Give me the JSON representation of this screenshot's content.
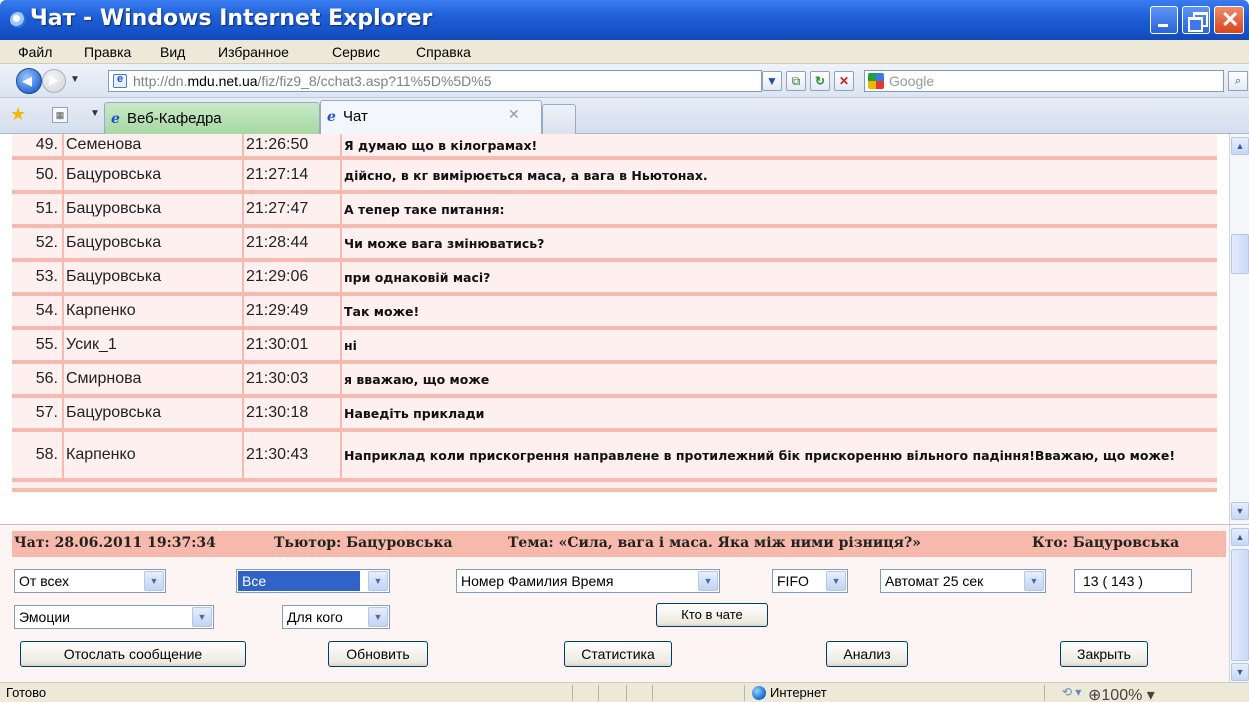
{
  "window": {
    "title": "Чат - Windows Internet Explorer"
  },
  "menu": [
    "Файл",
    "Правка",
    "Вид",
    "Избранное",
    "Сервис",
    "Справка"
  ],
  "address": {
    "url_pre": "http://dn.",
    "url_host": "mdu.net.ua",
    "url_post": "/fiz/fiz9_8/cchat3.asp?11%5D%5D%5",
    "search_placeholder": "Google"
  },
  "tabs": [
    {
      "label": "Веб-Кафедра",
      "active": false
    },
    {
      "label": "Чат",
      "active": true
    }
  ],
  "chat": {
    "rows": [
      {
        "num": "49.",
        "name": "Семенова",
        "time": "21:26:50",
        "message": "Я думаю що в кілограмах!"
      },
      {
        "num": "50.",
        "name": "Бацуровська",
        "time": "21:27:14",
        "message": "дійсно, в кг вимірюється маса, а вага в Ньютонах."
      },
      {
        "num": "51.",
        "name": "Бацуровська",
        "time": "21:27:47",
        "message": "А тепер таке питання:"
      },
      {
        "num": "52.",
        "name": "Бацуровська",
        "time": "21:28:44",
        "message": "Чи може вага змінюватись?"
      },
      {
        "num": "53.",
        "name": "Бацуровська",
        "time": "21:29:06",
        "message": "при однаковій масі?"
      },
      {
        "num": "54.",
        "name": "Карпенко",
        "time": "21:29:49",
        "message": "Так може!"
      },
      {
        "num": "55.",
        "name": "Усик_1",
        "time": "21:30:01",
        "message": "ні"
      },
      {
        "num": "56.",
        "name": "Смирнова",
        "time": "21:30:03",
        "message": "я вважаю, що може"
      },
      {
        "num": "57.",
        "name": "Бацуровська",
        "time": "21:30:18",
        "message": "Наведіть приклади"
      },
      {
        "num": "58.",
        "name": "Карпенко",
        "time": "21:30:43",
        "message": "Наприклад коли прискогрення направлене в протилежний бік прискоренню вільного падіння!Вважаю, що може!"
      }
    ]
  },
  "panel": {
    "chat_date": "Чат: 28.06.2011 19:37:34",
    "tutor": "Тьютор: Бацуровська",
    "topic": "Тема: «Сила, вага і маса. Яка між ними різниця?»",
    "who": "Кто: Бацуровська",
    "from_select": "От всех",
    "all_select": "Все",
    "sort_select": "Номер Фамилия Время",
    "order_select": "FIFO",
    "auto_select": "Автомат 25 сек",
    "count_value": "13  ( 143 )",
    "emotions_select": "Эмоции",
    "for_whom_select": "Для кого",
    "who_in_chat_button": "Кто в чате",
    "send_button": "Отослать сообщение",
    "refresh_button": "Обновить",
    "stats_button": "Статистика",
    "analysis_button": "Анализ",
    "close_button": "Закрыть"
  },
  "status": {
    "text": "Готово",
    "zone": "Интернет",
    "zoom": "100%"
  },
  "colors": {
    "row_bg": "#fff0f0",
    "row_border": "#f5bbb0",
    "panel_header": "#f7b9ab",
    "title_bar": "#1f5fd8"
  }
}
